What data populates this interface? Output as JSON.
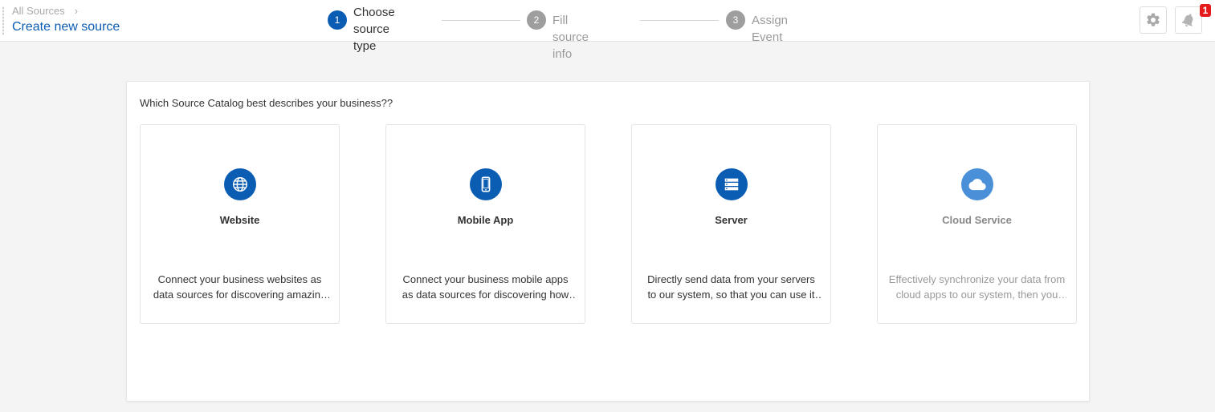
{
  "header": {
    "breadcrumb": "All Sources",
    "breadcrumb_chevron": "›",
    "title": "Create new source",
    "notification_count": "1"
  },
  "steps": [
    {
      "number": "1",
      "label_line1": "Choose source",
      "label_line2": "type",
      "state": "active"
    },
    {
      "number": "2",
      "label": "Fill source info",
      "state": "inactive"
    },
    {
      "number": "3",
      "label": "Assign Event",
      "state": "inactive"
    }
  ],
  "catalog": {
    "question": "Which Source Catalog best describes your business??",
    "cards": [
      {
        "title": "Website",
        "icon": "globe-icon",
        "description": "Connect your business websites as data sources for discovering amazing insights about your customers."
      },
      {
        "title": "Mobile App",
        "icon": "mobile-phone-icon",
        "description": "Connect your business mobile apps as data sources for discovering how your customers use your app."
      },
      {
        "title": "Server",
        "icon": "server-icon",
        "description": "Directly send data from your servers to our system, so that you can use it for deeper analysis."
      },
      {
        "title": "Cloud Service",
        "icon": "cloud-icon",
        "description": "Effectively synchronize your data from cloud apps to our system, then you can analyze it easily.",
        "disabled": true
      }
    ]
  },
  "colors": {
    "accent": "#0b5db3",
    "accent_disabled": "#4a90d9",
    "inactive_step": "#9e9e9e",
    "badge": "#e51b1b"
  }
}
